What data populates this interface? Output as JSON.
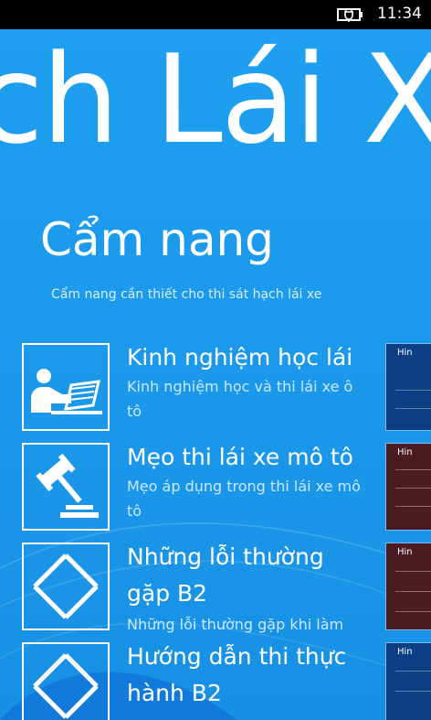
{
  "status_bar": {
    "time": "11:34",
    "battery_icon": "battery-charging-icon"
  },
  "panorama": {
    "title": "ch Lái X"
  },
  "section": {
    "title": "Cẩm nang",
    "subtitle": "Cẩm nang cần thiết cho thi sát hạch lái xe"
  },
  "items": [
    {
      "icon": "reading-person-icon",
      "title": "Kinh nghiệm học lái",
      "description_line1": "Kinh nghiệm học và thi lái xe ô",
      "description_line2": "tô"
    },
    {
      "icon": "gavel-icon",
      "title": "Mẹo thi lái xe mô tô",
      "description_line1": "Mẹo áp dụng trong thi lái xe mô",
      "description_line2": "tô"
    },
    {
      "icon": "arrows-cycle-icon",
      "title_line1": "Những lỗi thường",
      "title_line2": "gặp B2",
      "description_line1": "Những lỗi thường gặp khi làm"
    },
    {
      "icon": "arrows-cycle-icon",
      "title_line1": "Hướng dẫn thi thực",
      "title_line2": "hành B2"
    }
  ],
  "preview_tiles": [
    {
      "label": "Hin"
    },
    {
      "label": "Hin"
    },
    {
      "label": "Hin"
    },
    {
      "label": "Hin"
    }
  ],
  "colors": {
    "background": "#1fa0ee",
    "foreground": "#ffffff",
    "secondary_text": "#cbe8ff"
  }
}
